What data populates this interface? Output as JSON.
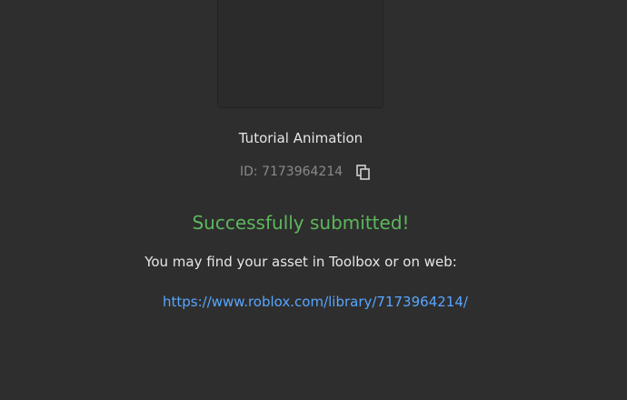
{
  "asset": {
    "name": "Tutorial Animation",
    "id_text": "ID: 7173964214"
  },
  "status": {
    "message": "Successfully submitted!",
    "color": "#5cb85c"
  },
  "hint": {
    "text": "You may find your asset in Toolbox or on web:"
  },
  "link": {
    "url": "https://www.roblox.com/library/7173964214/",
    "color": "#58a6ff"
  },
  "icons": {
    "copy": "copy-icon"
  }
}
